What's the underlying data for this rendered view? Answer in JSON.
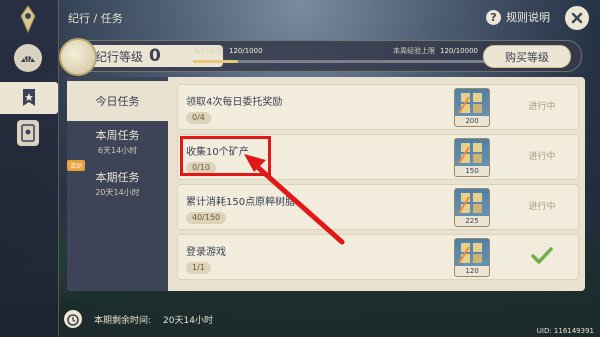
{
  "header": {
    "breadcrumb": "纪行 / 任务",
    "help_label": "规则说明",
    "help_icon": "?"
  },
  "level": {
    "label": "纪行等级",
    "value": "0",
    "xp_label": "纪行经验",
    "xp_value": "120/1000",
    "xp_progress": 0.12,
    "weekly_label": "本周经验上限",
    "weekly_value": "120/10000",
    "buy_label": "购买等级"
  },
  "tabs": [
    {
      "label": "今日任务",
      "sub": ""
    },
    {
      "label": "本周任务",
      "sub": "6天14小时"
    },
    {
      "label": "本期任务",
      "sub": "20天14小时",
      "tag": "活动"
    }
  ],
  "missions": [
    {
      "title": "领取4次每日委托奖励",
      "progress": "0/4",
      "reward": "200",
      "status": "进行中"
    },
    {
      "title": "收集10个矿产",
      "progress": "0/10",
      "reward": "150",
      "status": "进行中"
    },
    {
      "title": "累计消耗150点原粹树脂",
      "progress": "40/150",
      "reward": "225",
      "status": "进行中"
    },
    {
      "title": "登录游戏",
      "progress": "1/1",
      "reward": "120",
      "status": ""
    }
  ],
  "footer": {
    "remaining_label": "本期剩余时间:",
    "remaining_value": "20天14小时",
    "uid": "UID: 116149391"
  },
  "colors": {
    "accent": "#e7c77a",
    "highlight": "#e11818",
    "check": "#6fae48"
  }
}
